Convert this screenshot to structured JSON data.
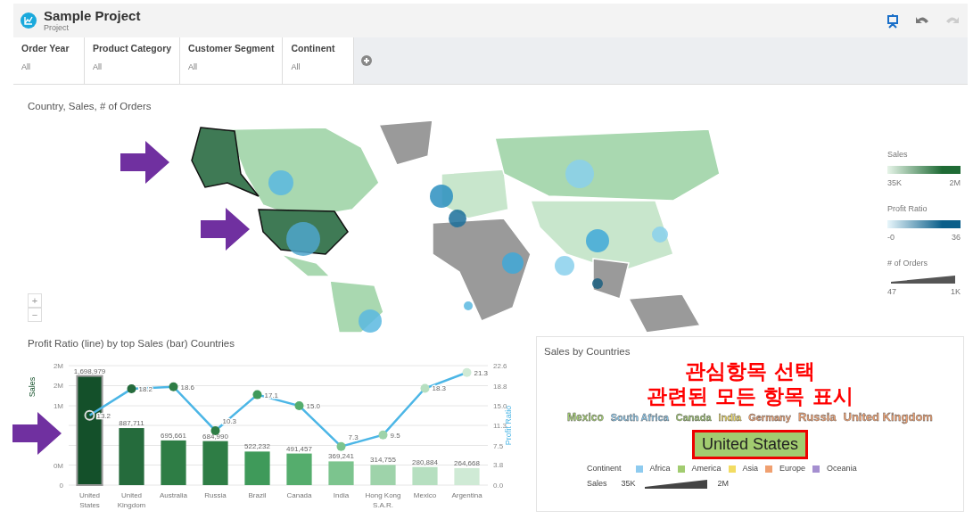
{
  "header": {
    "title": "Sample Project",
    "subtitle": "Project",
    "toolbar": [
      {
        "kind": "present",
        "disabled": false
      },
      {
        "kind": "undo",
        "disabled": false
      },
      {
        "kind": "redo",
        "disabled": true
      }
    ]
  },
  "filters": [
    {
      "label": "Order Year",
      "value": "All"
    },
    {
      "label": "Product Category",
      "value": "All"
    },
    {
      "label": "Customer Segment",
      "value": "All"
    },
    {
      "label": "Continent",
      "value": "All"
    }
  ],
  "map_panel": {
    "title": "Country, Sales, # of Orders",
    "legend": [
      {
        "kind": "gradient",
        "title": "Sales",
        "min": "35K",
        "max": "2M",
        "color": "#1f6b35"
      },
      {
        "kind": "gradient",
        "title": "Profit Ratio",
        "min": "-0",
        "max": "36",
        "color": "#0b5f8a"
      },
      {
        "kind": "size",
        "title": "# of Orders",
        "min": "47",
        "max": "1K"
      }
    ],
    "zoom": [
      "+",
      "−"
    ]
  },
  "combo_panel": {
    "title": "Profit Ratio (line) by top Sales (bar) Countries",
    "bar_selected": [
      true,
      false,
      false,
      false,
      false,
      false,
      false,
      false,
      false,
      false
    ],
    "chart_data": {
      "type": "bar",
      "categories": [
        "United States",
        "United Kingdom",
        "Australia",
        "Russia",
        "Brazil",
        "Canada",
        "India",
        "Hong Kong S.A.R.",
        "Mexico",
        "Argentina"
      ],
      "series": [
        {
          "name": "Sales",
          "type": "bar",
          "colors": [
            "#14502a",
            "#256b3c",
            "#2e7d45",
            "#2e7d45",
            "#3f9a5a",
            "#55ad6d",
            "#7cc48e",
            "#9ed3aa",
            "#b6dfc0",
            "#cfead5"
          ],
          "values": [
            1698979,
            887711,
            695661,
            684990,
            522232,
            491457,
            369241,
            314755,
            280884,
            264668
          ]
        },
        {
          "name": "Profit Ratio",
          "type": "line",
          "axis": "y2",
          "marker": "circle",
          "color": "#4cb6e6",
          "values": [
            13.2,
            18.2,
            18.6,
            10.3,
            17.1,
            15.0,
            7.3,
            9.5,
            18.3,
            21.3
          ]
        }
      ],
      "value_labels": [
        "1,698,979",
        "887,711",
        "695,661",
        "684,990",
        "522,232",
        "491,457",
        "369,241",
        "314,755",
        "280,884",
        "264,668"
      ],
      "annotations": [
        "13.2",
        "18.2",
        "18.6",
        "10.3",
        "17.1",
        "15.0",
        "7.3",
        "9.5",
        "18.3",
        "21.3"
      ],
      "grid": true,
      "ylim": [
        0,
        1860000
      ],
      "yticks": [
        {
          "value": 0,
          "label": "0"
        },
        {
          "value": 310000,
          "label": "0M"
        },
        {
          "value": 1240000,
          "label": "1M"
        },
        {
          "value": 1550000,
          "label": "2M"
        },
        {
          "value": 1860000,
          "label": "2M"
        }
      ],
      "y2lim": [
        0,
        22.6
      ],
      "y2ticks": [
        {
          "value": 0,
          "label": "0.0"
        },
        {
          "value": 3.8,
          "label": "3.8"
        },
        {
          "value": 7.5,
          "label": "7.5"
        },
        {
          "value": 11.3,
          "label": "11.3"
        },
        {
          "value": 15.0,
          "label": "15.0"
        },
        {
          "value": 18.8,
          "label": "18.8"
        },
        {
          "value": 22.6,
          "label": "22.6"
        }
      ]
    }
  },
  "cloud_panel": {
    "title": "Sales by Countries",
    "annotation": [
      "관심항목 선택",
      "관련된 모든 항목 표시"
    ],
    "words": [
      {
        "text": "Mexico",
        "color": "#a2cc70",
        "selected": false
      },
      {
        "text": "South Africa",
        "color": "#8ecbef",
        "selected": false
      },
      {
        "text": "Canada",
        "color": "#a2cc70",
        "selected": false
      },
      {
        "text": "India",
        "color": "#f2dc62",
        "selected": false
      },
      {
        "text": "Germany",
        "color": "#f0a070",
        "selected": false
      },
      {
        "text": "Russia",
        "color": "#f0a070",
        "selected": false
      },
      {
        "text": "United Kingdom",
        "color": "#f0a070",
        "selected": false
      },
      {
        "text": "United States",
        "color": "#a2cc70",
        "selected": true
      }
    ],
    "legend_title": "Continent",
    "continents": [
      {
        "name": "Africa",
        "color": "#8ecbef"
      },
      {
        "name": "America",
        "color": "#a2cc70"
      },
      {
        "name": "Asia",
        "color": "#f2dc62"
      },
      {
        "name": "Europe",
        "color": "#f0a070"
      },
      {
        "name": "Oceania",
        "color": "#a58fd0"
      }
    ],
    "size_legend": {
      "title": "Sales",
      "min": "35K",
      "max": "2M"
    }
  }
}
